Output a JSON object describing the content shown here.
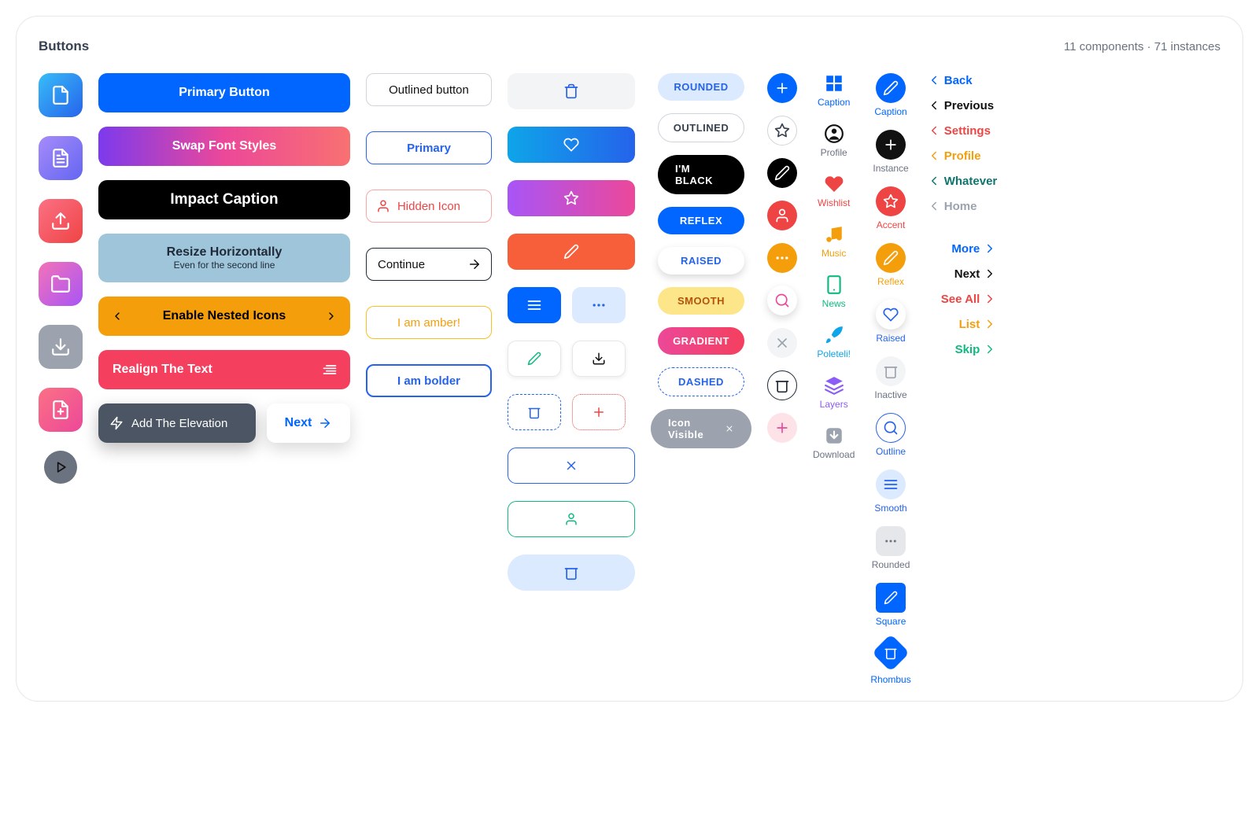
{
  "header": {
    "title": "Buttons",
    "meta": "11 components · 71 instances"
  },
  "wide": {
    "primary": "Primary Button",
    "swap": "Swap Font Styles",
    "impact": "Impact Caption",
    "resize": "Resize Horizontally",
    "resize_sub": "Even for the second line",
    "nested": "Enable Nested Icons",
    "realign": "Realign The Text",
    "elevation": "Add The Elevation",
    "next": "Next"
  },
  "medium": {
    "outlined": "Outlined button",
    "primary": "Primary",
    "hidden": "Hidden Icon",
    "continue": "Continue",
    "amber": "I am amber!",
    "bolder": "I am bolder"
  },
  "pills": {
    "rounded": "ROUNDED",
    "outlined": "OUTLINED",
    "black": "I'M BLACK",
    "reflex": "REFLEX",
    "raised": "RAISED",
    "smooth": "SMOOTH",
    "gradient": "GRADIENT",
    "dashed": "DASHED",
    "iconvis": "Icon Visible"
  },
  "caps": {
    "caption": "Caption",
    "profile": "Profile",
    "instance": "Instance",
    "wishlist": "Wishlist",
    "accent": "Accent",
    "music": "Music",
    "reflex": "Reflex",
    "news": "News",
    "raised": "Raised",
    "poleteli": "Poleteli!",
    "inactive": "Inactive",
    "layers": "Layers",
    "outline": "Outline",
    "download": "Download",
    "smooth": "Smooth",
    "rounded": "Rounded",
    "square": "Square",
    "rhombus": "Rhombus"
  },
  "links": {
    "back": "Back",
    "previous": "Previous",
    "settings": "Settings",
    "profile": "Profile",
    "whatever": "Whatever",
    "home": "Home",
    "more": "More",
    "next": "Next",
    "seeall": "See All",
    "list": "List",
    "skip": "Skip"
  }
}
